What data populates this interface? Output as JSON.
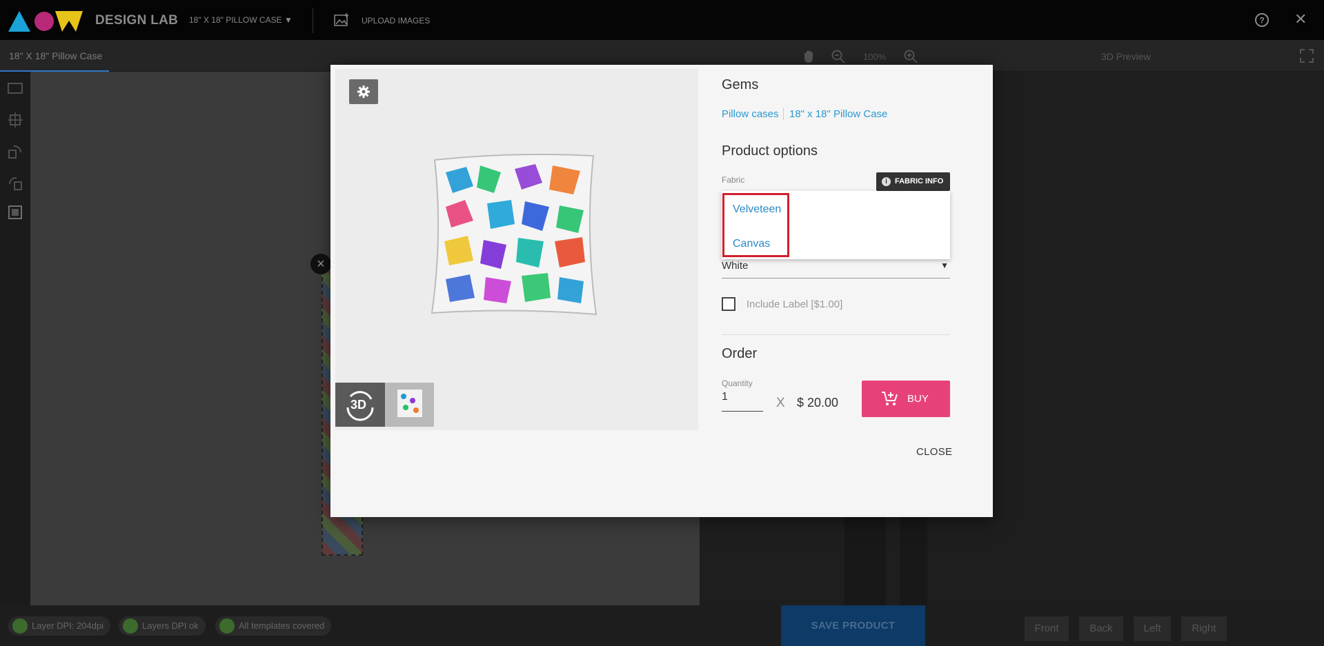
{
  "app": {
    "brand": "DESIGN LAB",
    "product_selector": "18\" X 18\" PILLOW CASE",
    "product_caret": "▼",
    "upload_label": "UPLOAD IMAGES",
    "close_glyph": "✕"
  },
  "subbar": {
    "active_tab": "18\" X 18\" Pillow Case",
    "zoom_level": "100%",
    "preview_label": "3D Preview"
  },
  "bottombar": {
    "chips": [
      "Layer DPI: 204dpi",
      "Layers DPI ok",
      "All templates covered"
    ],
    "save_label": "SAVE PRODUCT",
    "view_buttons": [
      "Front",
      "Back",
      "Left",
      "Right"
    ]
  },
  "modal": {
    "gallery": {
      "thumb_3d_label": "3D"
    },
    "product_title": "Gems",
    "breadcrumbs": [
      "Pillow cases",
      "18\" x 18\" Pillow Case"
    ],
    "options_heading": "Product options",
    "fabric_label": "Fabric",
    "fabric_info_label": "FABRIC INFO",
    "fabric_options": [
      "Velveteen",
      "Canvas"
    ],
    "color_value": "White",
    "color_caret": "▼",
    "include_label": "Include Label [$1.00]",
    "order_heading": "Order",
    "quantity_label": "Quantity",
    "quantity_value": "1",
    "times": "X",
    "price": "$ 20.00",
    "buy_label": "BUY",
    "close_label": "CLOSE"
  },
  "colors": {
    "accent_link": "#2a9ad2",
    "buy_button": "#e8417a",
    "highlight": "#d11f2e",
    "save_button": "#0d3a66"
  }
}
